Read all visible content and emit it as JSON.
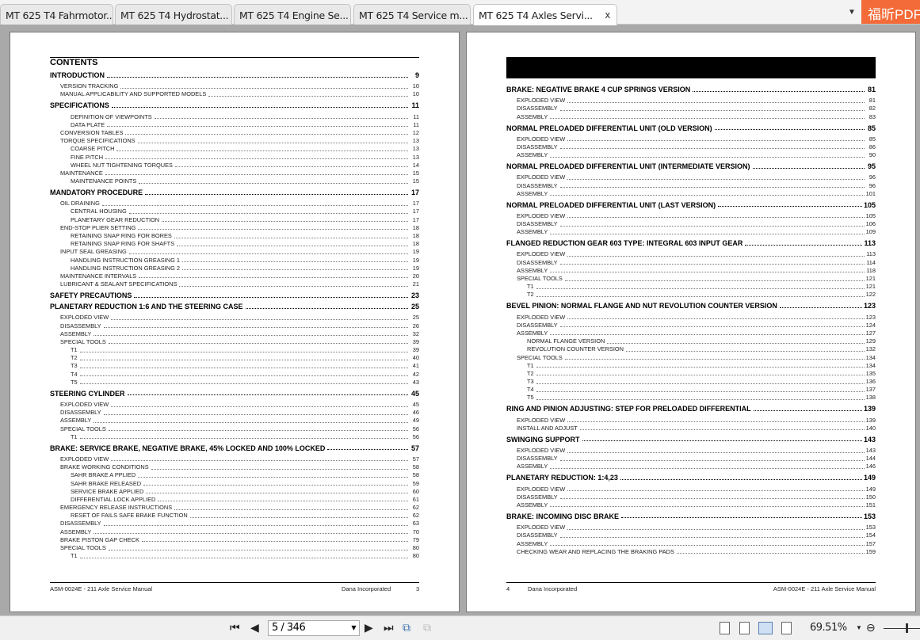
{
  "tabs": [
    {
      "label": "MT 625 T4 Fahrmotor..."
    },
    {
      "label": "MT 625 T4 Hydrostat..."
    },
    {
      "label": "MT 625 T4 Engine Se..."
    },
    {
      "label": "MT 625 T4 Service m..."
    },
    {
      "label": "MT 625 T4 Axles Servi...",
      "active": true
    }
  ],
  "tab_close": "x",
  "brand": "福昕PDF",
  "left_page": {
    "title": "CONTENTS",
    "entries": [
      [
        "INTRODUCTION",
        "9",
        0
      ],
      [
        "VERSION TRACKING",
        "10",
        1
      ],
      [
        "MANUAL APPLICABILITY AND SUPPORTED MODELS",
        "10",
        1
      ],
      [
        "SPECIFICATIONS",
        "11",
        0
      ],
      [
        "DEFINITION OF VIEWPOINTS",
        "11",
        2
      ],
      [
        "DATA PLATE",
        "11",
        2
      ],
      [
        "CONVERSION TABLES",
        "12",
        1
      ],
      [
        "TORQUE SPECIFICATIONS",
        "13",
        1
      ],
      [
        "COARSE PITCH",
        "13",
        2
      ],
      [
        "FINE PITCH",
        "13",
        2
      ],
      [
        "WHEEL NUT TIGHTENING TORQUES",
        "14",
        2
      ],
      [
        "MAINTENANCE",
        "15",
        1
      ],
      [
        "MAINTENANCE POINTS",
        "15",
        2
      ],
      [
        "MANDATORY PROCEDURE",
        "17",
        0
      ],
      [
        "OIL DRAINING",
        "17",
        1
      ],
      [
        "CENTRAL HOUSING",
        "17",
        2
      ],
      [
        "PLANETARY GEAR REDUCTION",
        "17",
        2
      ],
      [
        "END-STOP PLIER SETTING",
        "18",
        1
      ],
      [
        "RETAINING SNAP RING FOR BORES",
        "18",
        2
      ],
      [
        "RETAINING SNAP RING FOR SHAFTS",
        "18",
        2
      ],
      [
        "INPUT SEAL GREASING",
        "19",
        1
      ],
      [
        "HANDLING INSTRUCTION GREASING 1",
        "19",
        2
      ],
      [
        "HANDLING INSTRUCTION GREASING 2",
        "19",
        2
      ],
      [
        "MAINTENANCE INTERVALS",
        "20",
        1
      ],
      [
        "LUBRICANT & SEALANT SPECIFICATIONS",
        "21",
        1
      ],
      [
        "SAFETY PRECAUTIONS",
        "23",
        0
      ],
      [
        "PLANETARY REDUCTION 1:6 AND THE STEERING CASE",
        "25",
        0
      ],
      [
        "EXPLODED VIEW",
        "25",
        1
      ],
      [
        "DISASSEMBLY",
        "26",
        1
      ],
      [
        "ASSEMBLY",
        "32",
        1
      ],
      [
        "SPECIAL TOOLS",
        "39",
        1
      ],
      [
        "T1",
        "39",
        2
      ],
      [
        "T2",
        "40",
        2
      ],
      [
        "T3",
        "41",
        2
      ],
      [
        "T4",
        "42",
        2
      ],
      [
        "T5",
        "43",
        2
      ],
      [
        "STEERING CYLINDER",
        "45",
        0
      ],
      [
        "EXPLODED VIEW",
        "45",
        1
      ],
      [
        "DISASSEMBLY",
        "46",
        1
      ],
      [
        "ASSEMBLY",
        "49",
        1
      ],
      [
        "SPECIAL TOOLS",
        "56",
        1
      ],
      [
        "T1",
        "56",
        2
      ],
      [
        "BRAKE: SERVICE BRAKE, NEGATIVE BRAKE, 45% LOCKED AND 100% LOCKED",
        "57",
        0
      ],
      [
        "EXPLODED VIEW",
        "57",
        1
      ],
      [
        "BRAKE WORKING CONDITIONS",
        "58",
        1
      ],
      [
        "SAHR BRAKE A PPLIED",
        "58",
        2
      ],
      [
        "SAHR BRAKE RELEASED",
        "59",
        2
      ],
      [
        "SERVICE BRAKE APPLIED",
        "60",
        2
      ],
      [
        "DIFFERENTIAL LOCK APPLIED",
        "61",
        2
      ],
      [
        "EMERGENCY RELEASE INSTRUCTIONS",
        "62",
        1
      ],
      [
        "RESET OF FAILS SAFE BRAKE FUNCTION",
        "62",
        2
      ],
      [
        "DISASSEMBLY",
        "63",
        1
      ],
      [
        "ASSEMBLY",
        "70",
        1
      ],
      [
        "BRAKE PISTON GAP CHECK",
        "79",
        1
      ],
      [
        "SPECIAL TOOLS",
        "80",
        1
      ],
      [
        "T1",
        "80",
        2
      ]
    ],
    "footer_left": "ASM-0024E - 211 Axle Service Manual",
    "footer_company": "Dana Incorporated",
    "footer_page": "3"
  },
  "right_page": {
    "entries": [
      [
        "BRAKE: NEGATIVE BRAKE 4 CUP SPRINGS VERSION",
        "81",
        0
      ],
      [
        "EXPLODED VIEW",
        "81",
        1
      ],
      [
        "DISASSEMBLY",
        "82",
        1
      ],
      [
        "ASSEMBLY",
        "83",
        1
      ],
      [
        "NORMAL PRELOADED DIFFERENTIAL UNIT (OLD VERSION)",
        "85",
        0
      ],
      [
        "EXPLODED VIEW",
        "85",
        1
      ],
      [
        "DISASSEMBLY",
        "86",
        1
      ],
      [
        "ASSEMBLY",
        "90",
        1
      ],
      [
        "NORMAL PRELOADED DIFFERENTIAL UNIT (INTERMEDIATE VERSION)",
        "95",
        0
      ],
      [
        "EXPLODED VIEW",
        "96",
        1
      ],
      [
        "DISASSEMBLY",
        "96",
        1
      ],
      [
        "ASSEMBLY",
        "101",
        1
      ],
      [
        "NORMAL PRELOADED DIFFERENTIAL UNIT (LAST VERSION)",
        "105",
        0
      ],
      [
        "EXPLODED VIEW",
        "105",
        1
      ],
      [
        "DISASSEMBLY",
        "106",
        1
      ],
      [
        "ASSEMBLY",
        "109",
        1
      ],
      [
        "FLANGED REDUCTION GEAR 603 TYPE: INTEGRAL 603 INPUT GEAR",
        "113",
        0
      ],
      [
        "EXPLODED VIEW",
        "113",
        1
      ],
      [
        "DISASSEMBLY",
        "114",
        1
      ],
      [
        "ASSEMBLY",
        "118",
        1
      ],
      [
        "SPECIAL TOOLS",
        "121",
        1
      ],
      [
        "T1",
        "121",
        2
      ],
      [
        "T2",
        "122",
        2
      ],
      [
        "BEVEL PINION: NORMAL FLANGE AND NUT REVOLUTION COUNTER VERSION",
        "123",
        0
      ],
      [
        "EXPLODED VIEW",
        "123",
        1
      ],
      [
        "DISASSEMBLY",
        "124",
        1
      ],
      [
        "ASSEMBLY",
        "127",
        1
      ],
      [
        "NORMAL FLANGE VERSION",
        "129",
        2
      ],
      [
        "REVOLUTION COUNTER VERSION",
        "132",
        2
      ],
      [
        "SPECIAL TOOLS",
        "134",
        1
      ],
      [
        "T1",
        "134",
        2
      ],
      [
        "T2",
        "135",
        2
      ],
      [
        "T3",
        "136",
        2
      ],
      [
        "T4",
        "137",
        2
      ],
      [
        "T5",
        "138",
        2
      ],
      [
        "RING AND PINION ADJUSTING: STEP FOR PRELOADED DIFFERENTIAL",
        "139",
        0
      ],
      [
        "EXPLODED VIEW",
        "139",
        1
      ],
      [
        "INSTALL AND ADJUST",
        "140",
        1
      ],
      [
        "SWINGING SUPPORT",
        "143",
        0
      ],
      [
        "EXPLODED VIEW",
        "143",
        1
      ],
      [
        "DISASSEMBLY",
        "144",
        1
      ],
      [
        "ASSEMBLY",
        "146",
        1
      ],
      [
        "PLANETARY REDUCTION: 1:4,23",
        "149",
        0
      ],
      [
        "EXPLODED VIEW",
        "149",
        1
      ],
      [
        "DISASSEMBLY",
        "150",
        1
      ],
      [
        "ASSEMBLY",
        "151",
        1
      ],
      [
        "BRAKE: INCOMING DISC BRAKE",
        "153",
        0
      ],
      [
        "EXPLODED VIEW",
        "153",
        1
      ],
      [
        "DISASSEMBLY",
        "154",
        1
      ],
      [
        "ASSEMBLY",
        "157",
        1
      ],
      [
        "CHECKING WEAR AND REPLACING THE BRAKING PADS",
        "159",
        1
      ]
    ],
    "footer_page": "4",
    "footer_company": "Dana Incorporated",
    "footer_right": "ASM-0024E - 211 Axle Service Manual"
  },
  "toolbar": {
    "page_field": "5 / 346",
    "zoom": "69.51%",
    "icons": [
      "first-page-icon",
      "prev-page-icon",
      "next-page-icon",
      "last-page-icon",
      "previous-view-icon",
      "next-view-icon",
      "single-page-icon",
      "continuous-icon",
      "facing-icon",
      "continuous-facing-icon",
      "zoom-out-icon"
    ]
  }
}
